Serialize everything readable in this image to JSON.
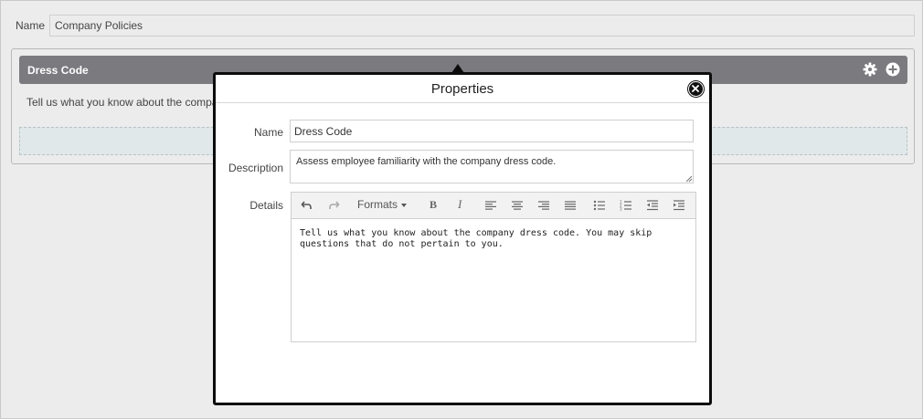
{
  "top": {
    "name_label": "Name",
    "name_value": "Company Policies"
  },
  "section": {
    "title": "Dress Code",
    "body_text": "Tell us what you know about the company d",
    "icons": [
      "gear-icon",
      "plus-circle-icon"
    ]
  },
  "modal": {
    "title": "Properties",
    "close_icon": "close-icon",
    "fields": {
      "name_label": "Name",
      "name_value": "Dress Code",
      "description_label": "Description",
      "description_value": "Assess employee familiarity with the company dress code.",
      "details_label": "Details"
    },
    "editor": {
      "toolbar": {
        "formats_label": "Formats",
        "bold_label": "B",
        "italic_label": "I",
        "buttons": [
          "undo-icon",
          "redo-icon",
          "formats-dropdown",
          "bold",
          "italic",
          "align-left-icon",
          "align-center-icon",
          "align-right-icon",
          "align-justify-icon",
          "bullet-list-icon",
          "numbered-list-icon",
          "outdent-icon",
          "indent-icon"
        ]
      },
      "content": "Tell us what you know about the company dress code. You may skip questions that do not pertain to you."
    }
  },
  "colors": {
    "background": "#ececec",
    "section_header": "#7a7a7f",
    "modal_border": "#0c0c0c",
    "drop_zone": "#e0e8ea"
  }
}
